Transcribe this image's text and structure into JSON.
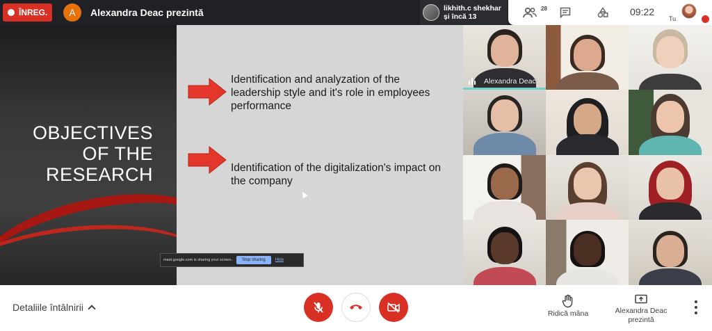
{
  "topbar": {
    "recording_label": "ÎNREG.",
    "presenter_initial": "A",
    "presenter_title": "Alexandra Deac prezintă",
    "attendee_name": "likhith.c shekhar",
    "attendee_more": "și încă 13",
    "people_count": "28",
    "clock": "09:22",
    "self_label": "Tu"
  },
  "slide": {
    "title": "OBJECTIVES\nOF THE\nRESEARCH",
    "bullet_1": "Identification and analyzation of the leadership style and it's role in employees performance",
    "bullet_2": "Identification of the digitalization's impact on the company",
    "share_text": "meet.google.com is sharing your screen.",
    "stop_sharing": "Stop sharing",
    "hide": "Hide"
  },
  "grid": {
    "active_speaker_name": "Alexandra Deac"
  },
  "bottombar": {
    "meeting_details": "Detaliile întâlnirii",
    "raise_hand": "Ridică mâna",
    "presenting": "Alexandra Deac prezintă"
  },
  "colors": {
    "accent_red": "#d93025",
    "speaking_teal": "#6cd2cb",
    "meet_dark": "#202124"
  }
}
